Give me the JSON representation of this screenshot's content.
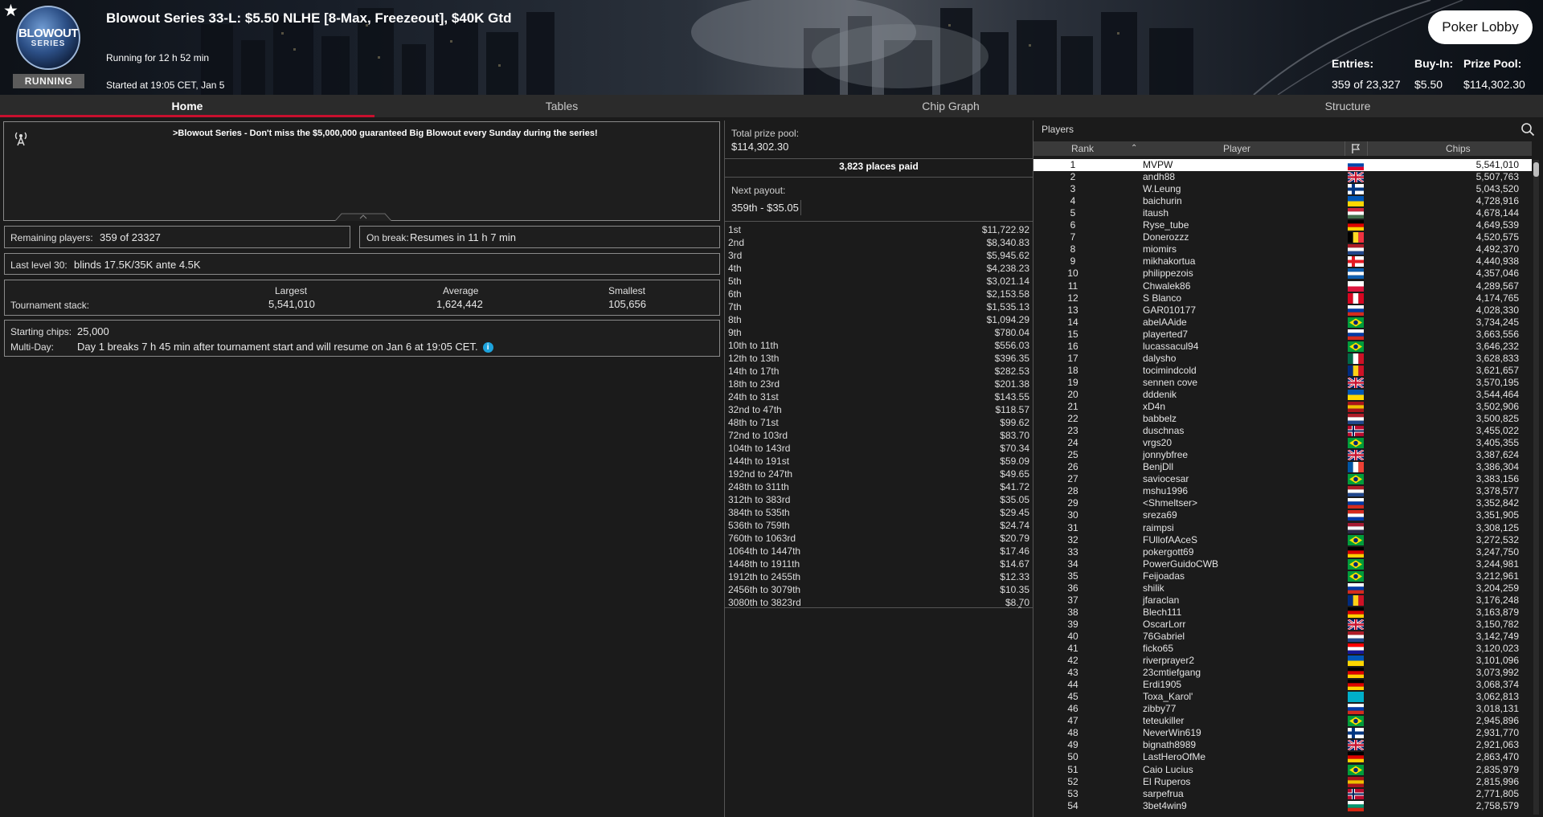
{
  "header": {
    "logo_line1": "BLOWOUT",
    "logo_line2": "SERIES",
    "status_badge": "RUNNING",
    "title": "Blowout Series 33-L: $5.50 NLHE [8-Max, Freezeout], $40K Gtd",
    "running_for": "Running for 12 h 52 min",
    "started_at": "Started at 19:05 CET, Jan 5",
    "lobby_button": "Poker Lobby",
    "entries_label": "Entries:",
    "entries_value": "359 of 23,327",
    "buyin_label": "Buy-In:",
    "buyin_value": "$5.50",
    "prizepool_label": "Prize Pool:",
    "prizepool_value": "$114,302.30",
    "favorite_icon": "star-icon"
  },
  "tabs": [
    {
      "label": "Home",
      "active": true
    },
    {
      "label": "Tables",
      "active": false
    },
    {
      "label": "Chip Graph",
      "active": false
    },
    {
      "label": "Structure",
      "active": false
    }
  ],
  "home": {
    "news_icon": "broadcast-icon",
    "news_text": ">Blowout Series - Don't miss the $5,000,000 guaranteed Big Blowout every Sunday during the series!",
    "remaining_label": "Remaining players:",
    "remaining_value": "359 of 23327",
    "break_label": "On break:",
    "break_value": "Resumes in 11 h 7 min",
    "last_level_label": "Last level 30:",
    "last_level_value": "blinds 17.5K/35K ante 4.5K",
    "stack_label": "Tournament stack:",
    "largest_label": "Largest",
    "largest_value": "5,541,010",
    "average_label": "Average",
    "average_value": "1,624,442",
    "smallest_label": "Smallest",
    "smallest_value": "105,656",
    "starting_chips_label": "Starting chips:",
    "starting_chips_value": "25,000",
    "multiday_label": "Multi-Day:",
    "multiday_value": "Day 1 breaks 7 h 45 min after tournament start and will resume on Jan 6 at 19:05 CET.",
    "info_icon": "info-icon"
  },
  "payouts": {
    "total_label": "Total prize pool:",
    "total_value": "$114,302.30",
    "places_paid": "3,823 places paid",
    "next_label": "Next payout:",
    "next_value": "359th - $35.05",
    "rows": [
      {
        "place": "1st",
        "amount": "$11,722.92"
      },
      {
        "place": "2nd",
        "amount": "$8,340.83"
      },
      {
        "place": "3rd",
        "amount": "$5,945.62"
      },
      {
        "place": "4th",
        "amount": "$4,238.23"
      },
      {
        "place": "5th",
        "amount": "$3,021.14"
      },
      {
        "place": "6th",
        "amount": "$2,153.58"
      },
      {
        "place": "7th",
        "amount": "$1,535.13"
      },
      {
        "place": "8th",
        "amount": "$1,094.29"
      },
      {
        "place": "9th",
        "amount": "$780.04"
      },
      {
        "place": "10th to 11th",
        "amount": "$556.03"
      },
      {
        "place": "12th to 13th",
        "amount": "$396.35"
      },
      {
        "place": "14th to 17th",
        "amount": "$282.53"
      },
      {
        "place": "18th to 23rd",
        "amount": "$201.38"
      },
      {
        "place": "24th to 31st",
        "amount": "$143.55"
      },
      {
        "place": "32nd to 47th",
        "amount": "$118.57"
      },
      {
        "place": "48th to 71st",
        "amount": "$99.62"
      },
      {
        "place": "72nd to 103rd",
        "amount": "$83.70"
      },
      {
        "place": "104th to 143rd",
        "amount": "$70.34"
      },
      {
        "place": "144th to 191st",
        "amount": "$59.09"
      },
      {
        "place": "192nd to 247th",
        "amount": "$49.65"
      },
      {
        "place": "248th to 311th",
        "amount": "$41.72"
      },
      {
        "place": "312th to 383rd",
        "amount": "$35.05"
      },
      {
        "place": "384th to 535th",
        "amount": "$29.45"
      },
      {
        "place": "536th to 759th",
        "amount": "$24.74"
      },
      {
        "place": "760th to 1063rd",
        "amount": "$20.79"
      },
      {
        "place": "1064th to 1447th",
        "amount": "$17.46"
      },
      {
        "place": "1448th to 1911th",
        "amount": "$14.67"
      },
      {
        "place": "1912th to 2455th",
        "amount": "$12.33"
      },
      {
        "place": "2456th to 3079th",
        "amount": "$10.35"
      },
      {
        "place": "3080th to 3823rd",
        "amount": "$8.70"
      }
    ]
  },
  "players": {
    "panel_title": "Players",
    "search_icon": "search-icon",
    "col_rank": "Rank",
    "col_player": "Player",
    "col_chips": "Chips",
    "rows": [
      {
        "rank": "1",
        "name": "MVPW",
        "flag": "SI",
        "chips": "5,541,010"
      },
      {
        "rank": "2",
        "name": "andh88",
        "flag": "GB",
        "chips": "5,507,763"
      },
      {
        "rank": "3",
        "name": "W.Leung",
        "flag": "FI",
        "chips": "5,043,520"
      },
      {
        "rank": "4",
        "name": "baichurin",
        "flag": "UA",
        "chips": "4,728,916"
      },
      {
        "rank": "5",
        "name": "itaush",
        "flag": "HU",
        "chips": "4,678,144"
      },
      {
        "rank": "6",
        "name": "Ryse_tube",
        "flag": "DE",
        "chips": "4,649,539"
      },
      {
        "rank": "7",
        "name": "Donerozzz",
        "flag": "BE",
        "chips": "4,520,575"
      },
      {
        "rank": "8",
        "name": "miomirs",
        "flag": "NL",
        "chips": "4,492,370"
      },
      {
        "rank": "9",
        "name": "mikhakortua",
        "flag": "GE",
        "chips": "4,440,938"
      },
      {
        "rank": "10",
        "name": "philippezois",
        "flag": "GR",
        "chips": "4,357,046"
      },
      {
        "rank": "11",
        "name": "Chwalek86",
        "flag": "PL",
        "chips": "4,289,567"
      },
      {
        "rank": "12",
        "name": "S Blanco",
        "flag": "CA",
        "chips": "4,174,765"
      },
      {
        "rank": "13",
        "name": "GAR010177",
        "flag": "RU",
        "chips": "4,028,330"
      },
      {
        "rank": "14",
        "name": "abelAAide",
        "flag": "BR",
        "chips": "3,734,245"
      },
      {
        "rank": "15",
        "name": "playerted7",
        "flag": "RU",
        "chips": "3,663,556"
      },
      {
        "rank": "16",
        "name": "lucassacul94",
        "flag": "BR",
        "chips": "3,646,232"
      },
      {
        "rank": "17",
        "name": "dalysho",
        "flag": "MX",
        "chips": "3,628,833"
      },
      {
        "rank": "18",
        "name": "tocimindcold",
        "flag": "RO",
        "chips": "3,621,657"
      },
      {
        "rank": "19",
        "name": "sennen cove",
        "flag": "GB",
        "chips": "3,570,195"
      },
      {
        "rank": "20",
        "name": "dddenik",
        "flag": "UA",
        "chips": "3,544,464"
      },
      {
        "rank": "21",
        "name": "xD4n",
        "flag": "ES",
        "chips": "3,502,906"
      },
      {
        "rank": "22",
        "name": "babbelz",
        "flag": "NL",
        "chips": "3,500,825"
      },
      {
        "rank": "23",
        "name": "duschnas",
        "flag": "NO",
        "chips": "3,455,022"
      },
      {
        "rank": "24",
        "name": "vrgs20",
        "flag": "BR",
        "chips": "3,405,355"
      },
      {
        "rank": "25",
        "name": "jonnybfree",
        "flag": "GB",
        "chips": "3,387,624"
      },
      {
        "rank": "26",
        "name": "BenjDll",
        "flag": "FR",
        "chips": "3,386,304"
      },
      {
        "rank": "27",
        "name": "saviocesar",
        "flag": "BR",
        "chips": "3,383,156"
      },
      {
        "rank": "28",
        "name": "mshu1996",
        "flag": "NL",
        "chips": "3,378,577"
      },
      {
        "rank": "29",
        "name": "<Shmeltser>",
        "flag": "RU",
        "chips": "3,352,842"
      },
      {
        "rank": "30",
        "name": "sreza69",
        "flag": "PY",
        "chips": "3,351,905"
      },
      {
        "rank": "31",
        "name": "raimpsi",
        "flag": "TH",
        "chips": "3,308,125"
      },
      {
        "rank": "32",
        "name": "FUllofAAceS",
        "flag": "BR",
        "chips": "3,272,532"
      },
      {
        "rank": "33",
        "name": "pokergott69",
        "flag": "DE",
        "chips": "3,247,750"
      },
      {
        "rank": "34",
        "name": "PowerGuidoCWB",
        "flag": "BR",
        "chips": "3,244,981"
      },
      {
        "rank": "35",
        "name": "Feijoadas",
        "flag": "BR",
        "chips": "3,212,961"
      },
      {
        "rank": "36",
        "name": "shilik",
        "flag": "RU",
        "chips": "3,204,259"
      },
      {
        "rank": "37",
        "name": "jfaraclan",
        "flag": "RO",
        "chips": "3,176,248"
      },
      {
        "rank": "38",
        "name": "Blech111",
        "flag": "DE",
        "chips": "3,163,879"
      },
      {
        "rank": "39",
        "name": "OscarLorr",
        "flag": "GB",
        "chips": "3,150,782"
      },
      {
        "rank": "40",
        "name": "76Gabriel",
        "flag": "NL",
        "chips": "3,142,749"
      },
      {
        "rank": "41",
        "name": "ficko65",
        "flag": "HR",
        "chips": "3,120,023"
      },
      {
        "rank": "42",
        "name": "riverprayer2",
        "flag": "UA",
        "chips": "3,101,096"
      },
      {
        "rank": "43",
        "name": "23cmtiefgang",
        "flag": "DE",
        "chips": "3,073,992"
      },
      {
        "rank": "44",
        "name": "Erdi1905",
        "flag": "DE",
        "chips": "3,068,374"
      },
      {
        "rank": "45",
        "name": "Toxa_Karol'",
        "flag": "KZ",
        "chips": "3,062,813"
      },
      {
        "rank": "46",
        "name": "zibby77",
        "flag": "RU",
        "chips": "3,018,131"
      },
      {
        "rank": "47",
        "name": "teteukiller",
        "flag": "BR",
        "chips": "2,945,896"
      },
      {
        "rank": "48",
        "name": "NeverWin619",
        "flag": "FI",
        "chips": "2,931,770"
      },
      {
        "rank": "49",
        "name": "bignath8989",
        "flag": "GB",
        "chips": "2,921,063"
      },
      {
        "rank": "50",
        "name": "LastHeroOfMe",
        "flag": "DE",
        "chips": "2,863,470"
      },
      {
        "rank": "51",
        "name": "Caio Lucius",
        "flag": "BR",
        "chips": "2,835,979"
      },
      {
        "rank": "52",
        "name": "El Ruperos",
        "flag": "ES",
        "chips": "2,815,996"
      },
      {
        "rank": "53",
        "name": "sarpefrua",
        "flag": "NO",
        "chips": "2,771,805"
      },
      {
        "rank": "54",
        "name": "3bet4win9",
        "flag": "BG",
        "chips": "2,758,579"
      }
    ]
  },
  "colors": {
    "accent_red": "#c8102e",
    "background": "#1b1b1b",
    "info_blue": "#1da3dd"
  }
}
